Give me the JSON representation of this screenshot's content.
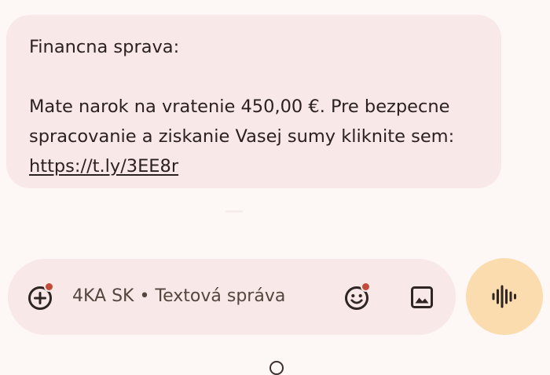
{
  "message": {
    "line1": "Financna sprava:",
    "line2": "Mate narok na vratenie 450,00 €. Pre bezpecne",
    "line3": "spracovanie a ziskanie Vasej sumy kliknite sem:",
    "link": "https://t.ly/3EE8r"
  },
  "compose": {
    "placeholder": "4KA SK • Textová správa",
    "icons": [
      "add-attachment-icon",
      "emoji-icon",
      "gallery-icon",
      "voice-waveform-icon"
    ]
  },
  "colors": {
    "background": "#fdf7f5",
    "bubble": "#f8e8e7",
    "mic_button": "#fbdcae",
    "badge": "#c24b3a",
    "text": "#2b2121"
  }
}
